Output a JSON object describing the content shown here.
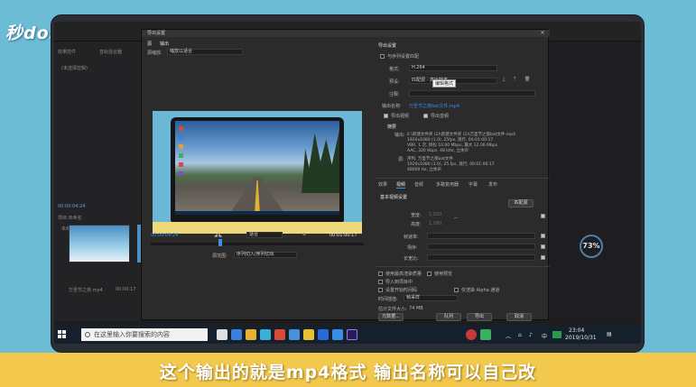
{
  "watermark": {
    "logo_text": "秒dong视频"
  },
  "premiere": {
    "left_panel": {
      "header": "效果控件",
      "tab": "音轨混合器",
      "empty_text": "(未选择剪辑)",
      "timecode": "00:00:04:24",
      "project_tab": "项目:未命名",
      "bin_name": "未命名.prproj",
      "clip_label": "万圣节之夜.mp4",
      "clip_duration": "00:00:17"
    },
    "right_gauge": "73%"
  },
  "dialog": {
    "title": "导出设置",
    "left_tabs": [
      "源",
      "输出"
    ],
    "source_scale_label": "源缩放:",
    "source_scale_value": "缩放以适合",
    "timecode_left": "00:00:04:24",
    "fit_label": "适合",
    "timecode_right": "00:01:00:17",
    "source_range_label": "源范围:",
    "source_range_value": "序列切入/序列切出",
    "export_settings_header": "导出设置",
    "match_sequence_label": "与序列设置匹配",
    "format_label": "格式:",
    "format_value": "H.264",
    "preset_label": "预设:",
    "preset_value": "匹配源 - 高比特率",
    "tooltip": "编辑格式",
    "comment_label": "注释:",
    "output_name_label": "输出名称:",
    "output_name_value": "万圣节之夜bat文件.mp4",
    "export_video_label": "导出视频",
    "export_audio_label": "导出音频",
    "summary_header": "摘要",
    "summary_output_label": "输出:",
    "summary_output_lines": [
      "E:\\新建文件夹 (2)\\新建文件夹 (2)\\万圣节之夜bat文件.mp4",
      "1920x1080 (1.0), 25fps, 逐行, 00:01:00:17",
      "VBR, 1 次, 目标 10.00 Mbps, 最大 12.00 Mbps",
      "AAC, 320 Kbps, 48 kHz, 立体声"
    ],
    "summary_source_label": "源:",
    "summary_source_lines": [
      "序列, 万圣节之夜bat文件",
      "1920x1080 (1.0), 25 fps, 逐行, 00:01:00:17",
      "48000 Hz, 立体声"
    ],
    "tabs": [
      "效果",
      "视频",
      "音频",
      "多路复用器",
      "字幕",
      "发布"
    ],
    "basic_video_header": "基本视频设置",
    "match_source_button": "匹配源",
    "width_label": "宽度:",
    "width_value": "1,920",
    "height_label": "高度:",
    "height_value": "1,080",
    "frame_rate_label": "帧速率:",
    "field_order_label": "场序:",
    "aspect_label": "长宽比:",
    "max_render_quality": "使用最高渲染质量",
    "use_previews": "使用预览",
    "import_to_project": "导入到项目中",
    "set_start_timecode": "设置开始时间码",
    "render_alpha_only": "仅渲染 Alpha 通道",
    "time_interp_label": "时间插值:",
    "time_interp_value": "帧采样",
    "file_size_label": "估计文件大小:",
    "file_size_value": "74 MB",
    "metadata_button": "元数据...",
    "queue_button": "队列",
    "export_button": "导出",
    "cancel_button": "取消"
  },
  "taskbar": {
    "search_placeholder": "在这里输入你要搜索的内容",
    "time": "23:04",
    "date": "2019/10/31",
    "lang": "中"
  },
  "subtitle": "这个输出的就是mp4格式 输出名称可以自己改"
}
